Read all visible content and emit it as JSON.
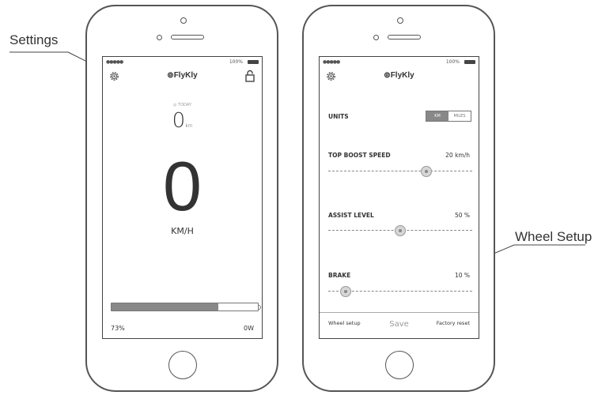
{
  "annotations": {
    "settings": "Settings",
    "wheel_setup": "Wheel Setup"
  },
  "status_bar": {
    "signal": "●●●●● ",
    "battery_percent": "100%"
  },
  "brand": "FlyKly",
  "icons": {
    "settings": "gear-icon",
    "lock": "lock-icon",
    "brand": "pin-icon"
  },
  "dashboard": {
    "odometer_label": "TODAY",
    "odometer_value": "0",
    "odometer_unit": "km",
    "speed_value": "0",
    "speed_unit": "KM/H",
    "battery_level": 0.73,
    "battery_percent": "73%",
    "power": "0W"
  },
  "settings": {
    "units_label": "UNITS",
    "units_options": [
      "KM",
      "MILES"
    ],
    "units_selected": "KM",
    "top_boost_label": "TOP BOOST SPEED",
    "top_boost_value": "20 km/h",
    "top_boost_level": 0.68,
    "assist_label": "ASSIST LEVEL",
    "assist_value": "50 %",
    "assist_level": 0.5,
    "brake_label": "BRAKE",
    "brake_value": "10 %",
    "brake_level": 0.12,
    "wheel_setup_link": "Wheel setup",
    "factory_reset_link": "Factory reset",
    "save_label": "Save"
  },
  "colors": {
    "outline": "#555555",
    "fill_gray": "#888888"
  }
}
